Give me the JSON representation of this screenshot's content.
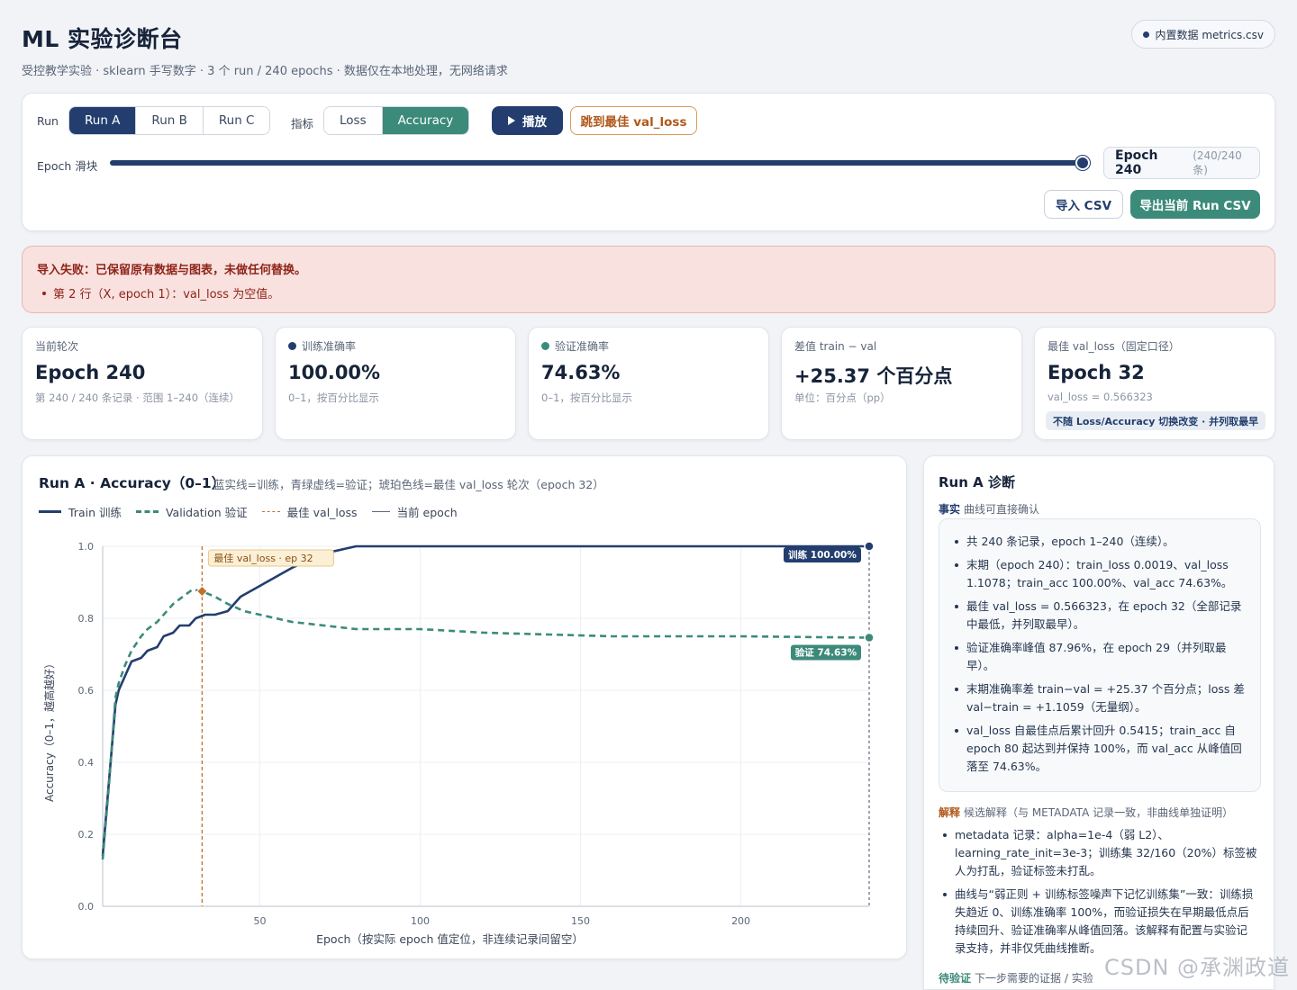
{
  "header": {
    "title": "ML 实验诊断台",
    "subtitle": "受控教学实验 · sklearn 手写数字 · 3 个 run / 240 epochs · 数据仅在本地处理，无网络请求",
    "data_source": "内置数据 metrics.csv"
  },
  "controls": {
    "run_label": "Run",
    "runs": [
      "Run A",
      "Run B",
      "Run C"
    ],
    "active_run": "Run A",
    "metric_label": "指标",
    "metrics": [
      "Loss",
      "Accuracy"
    ],
    "active_metric": "Accuracy",
    "play_label": "播放",
    "jump_label": "跳到最佳 val_loss",
    "slider_label": "Epoch 滑块",
    "slider_value": 240,
    "slider_max": 240,
    "epoch_main": "Epoch 240",
    "epoch_sub": "(240/240 条)",
    "import_label": "导入 CSV",
    "export_label": "导出当前 Run CSV"
  },
  "error": {
    "title": "导入失败：已保留原有数据与图表，未做任何替换。",
    "items": [
      "第 2 行（X, epoch 1）：val_loss 为空值。"
    ]
  },
  "stats": [
    {
      "label": "当前轮次",
      "value": "Epoch 240",
      "note": "第 240 / 240 条记录 · 范围 1–240（连续）"
    },
    {
      "label": "训练准确率",
      "value": "100.00%",
      "note": "0–1，按百分比显示",
      "dot_color": "#233e6e"
    },
    {
      "label": "验证准确率",
      "value": "74.63%",
      "note": "0–1，按百分比显示",
      "dot_color": "#3c8a7a"
    },
    {
      "label": "差值 train − val",
      "value": "+25.37 个百分点",
      "note": "单位：百分点（pp）"
    },
    {
      "label": "最佳 val_loss（固定口径）",
      "value": "Epoch 32",
      "note": "val_loss = 0.566323",
      "tag": "不随 Loss/Accuracy 切换改变 · 并列取最早"
    }
  ],
  "chart": {
    "title": "Run A · Accuracy（0–1）",
    "description": "蓝实线=训练，青绿虚线=验证；琥珀色线=最佳 val_loss 轮次（epoch 32）",
    "legend": {
      "train": "Train 训练",
      "val": "Validation 验证",
      "best": "最佳 val_loss",
      "current": "当前 epoch"
    },
    "best_annotation": "最佳 val_loss · ep 32",
    "train_end_label": "训练 100.00%",
    "val_end_label": "验证 74.63%",
    "ylabel": "Accuracy（0–1，越高越好）",
    "xlabel": "Epoch（按实际 epoch 值定位，非连续记录间留空）",
    "y_ticks": [
      "0.0",
      "0.2",
      "0.4",
      "0.6",
      "0.8",
      "1.0"
    ],
    "x_ticks": [
      "50",
      "100",
      "150",
      "200"
    ],
    "colors": {
      "train": "#233e6e",
      "val": "#3c8a7a",
      "best": "#c2702a",
      "current": "#5a6784"
    }
  },
  "chart_data": {
    "type": "line",
    "title": "Run A · Accuracy（0–1）",
    "xlabel": "Epoch（按实际 epoch 值定位，非连续记录间留空）",
    "ylabel": "Accuracy（0–1，越高越好）",
    "xlim": [
      1,
      240
    ],
    "ylim": [
      0,
      1
    ],
    "x_ticks": [
      50,
      100,
      150,
      200
    ],
    "y_ticks": [
      0,
      0.2,
      0.4,
      0.6,
      0.8,
      1.0
    ],
    "grid": true,
    "legend_position": "top-left",
    "best_val_loss_epoch": 32,
    "current_epoch": 240,
    "series": [
      {
        "name": "Train 训练",
        "style": "solid",
        "x": [
          1,
          3,
          5,
          6,
          8,
          10,
          13,
          15,
          18,
          20,
          23,
          25,
          28,
          30,
          33,
          36,
          40,
          44,
          48,
          52,
          56,
          60,
          65,
          70,
          80,
          120,
          160,
          200,
          240
        ],
        "y": [
          0.14,
          0.35,
          0.56,
          0.6,
          0.64,
          0.68,
          0.69,
          0.71,
          0.72,
          0.75,
          0.76,
          0.78,
          0.78,
          0.8,
          0.81,
          0.81,
          0.82,
          0.86,
          0.88,
          0.9,
          0.92,
          0.94,
          0.96,
          0.98,
          1.0,
          1.0,
          1.0,
          1.0,
          1.0
        ]
      },
      {
        "name": "Validation 验证",
        "style": "dashed",
        "x": [
          1,
          3,
          5,
          6,
          8,
          10,
          13,
          15,
          18,
          20,
          23,
          26,
          29,
          32,
          36,
          40,
          45,
          50,
          60,
          70,
          80,
          90,
          100,
          120,
          140,
          160,
          180,
          200,
          220,
          240
        ],
        "y": [
          0.13,
          0.34,
          0.58,
          0.62,
          0.67,
          0.71,
          0.75,
          0.77,
          0.79,
          0.81,
          0.84,
          0.86,
          0.88,
          0.875,
          0.86,
          0.84,
          0.82,
          0.81,
          0.79,
          0.78,
          0.77,
          0.77,
          0.77,
          0.76,
          0.755,
          0.75,
          0.75,
          0.75,
          0.748,
          0.7463
        ]
      }
    ]
  },
  "diagnosis": {
    "title": "Run A 诊断",
    "facts_key": "事实",
    "facts_label": "曲线可直接确认",
    "facts": [
      "共 240 条记录，epoch 1–240（连续）。",
      "末期（epoch 240）：train_loss 0.0019、val_loss 1.1078；train_acc 100.00%、val_acc 74.63%。",
      "最佳 val_loss = 0.566323，在 epoch 32（全部记录中最低，并列取最早）。",
      "验证准确率峰值 87.96%，在 epoch 29（并列取最早）。",
      "末期准确率差 train−val = +25.37 个百分点；loss 差 val−train = +1.1059（无量纲）。",
      "val_loss 自最佳点后累计回升 0.5415；train_acc 自 epoch 80 起达到并保持 100%，而 val_acc 从峰值回落至 74.63%。"
    ],
    "interp_key": "解释",
    "interp_label": "候选解释（与 METADATA 记录一致，非曲线单独证明）",
    "interp": [
      "metadata 记录：alpha=1e-4（弱 L2）、learning_rate_init=3e-3；训练集 32/160（20%）标签被人为打乱，验证标签未打乱。",
      "曲线与“弱正则 + 训练标签噪声下记忆训练集”一致：训练损失趋近 0、训练准确率 100%，而验证损失在早期最低点后持续回升、验证准确率从峰值回落。该解释有配置与实验记录支持，并非仅凭曲线推断。"
    ],
    "pending_key": "待验证",
    "pending_label": "下一步需要的证据 / 实验"
  },
  "watermark": "CSDN @承渊政道"
}
